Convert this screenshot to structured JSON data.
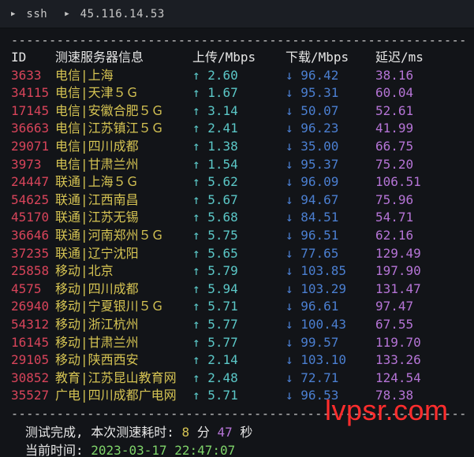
{
  "titlebar": {
    "shell": "ssh",
    "host": "45.116.14.53"
  },
  "separator": "----------------------------------------------------------------------------------",
  "columns": {
    "id": "ID",
    "server": "测速服务器信息",
    "upload": "上传/Mbps",
    "download": "下载/Mbps",
    "latency": "延迟/ms"
  },
  "rows": [
    {
      "id": "3633",
      "server": "电信|上海",
      "upload": "↑ 2.60",
      "download": "↓ 96.42",
      "latency": "38.16"
    },
    {
      "id": "34115",
      "server": "电信|天津５Ｇ",
      "upload": "↑ 1.67",
      "download": "↓ 95.31",
      "latency": "60.04"
    },
    {
      "id": "17145",
      "server": "电信|安徽合肥５Ｇ",
      "upload": "↑ 3.14",
      "download": "↓ 50.07",
      "latency": "52.61"
    },
    {
      "id": "36663",
      "server": "电信|江苏镇江５Ｇ",
      "upload": "↑ 2.41",
      "download": "↓ 96.23",
      "latency": "41.99"
    },
    {
      "id": "29071",
      "server": "电信|四川成都",
      "upload": "↑ 1.38",
      "download": "↓ 35.00",
      "latency": "66.75"
    },
    {
      "id": "3973",
      "server": "电信|甘肃兰州",
      "upload": "↑ 1.54",
      "download": "↓ 95.37",
      "latency": "75.20"
    },
    {
      "id": "24447",
      "server": "联通|上海５Ｇ",
      "upload": "↑ 5.62",
      "download": "↓ 96.09",
      "latency": "106.51"
    },
    {
      "id": "54625",
      "server": "联通|江西南昌",
      "upload": "↑ 5.67",
      "download": "↓ 94.67",
      "latency": "75.96"
    },
    {
      "id": "45170",
      "server": "联通|江苏无锡",
      "upload": "↑ 5.68",
      "download": "↓ 84.51",
      "latency": "54.71"
    },
    {
      "id": "36646",
      "server": "联通|河南郑州５Ｇ",
      "upload": "↑ 5.75",
      "download": "↓ 96.51",
      "latency": "62.16"
    },
    {
      "id": "37235",
      "server": "联通|辽宁沈阳",
      "upload": "↑ 5.65",
      "download": "↓ 77.65",
      "latency": "129.49"
    },
    {
      "id": "25858",
      "server": "移动|北京",
      "upload": "↑ 5.79",
      "download": "↓ 103.85",
      "latency": "197.90"
    },
    {
      "id": "4575",
      "server": "移动|四川成都",
      "upload": "↑ 5.94",
      "download": "↓ 103.29",
      "latency": "131.47"
    },
    {
      "id": "26940",
      "server": "移动|宁夏银川５Ｇ",
      "upload": "↑ 5.71",
      "download": "↓ 96.61",
      "latency": "97.47"
    },
    {
      "id": "54312",
      "server": "移动|浙江杭州",
      "upload": "↑ 5.77",
      "download": "↓ 100.43",
      "latency": "67.55"
    },
    {
      "id": "16145",
      "server": "移动|甘肃兰州",
      "upload": "↑ 5.77",
      "download": "↓ 99.57",
      "latency": "119.70"
    },
    {
      "id": "29105",
      "server": "移动|陕西西安",
      "upload": "↑ 2.14",
      "download": "↓ 103.10",
      "latency": "133.26"
    },
    {
      "id": "30852",
      "server": "教育|江苏昆山教育网",
      "upload": "↑ 2.48",
      "download": "↓ 72.71",
      "latency": "124.54"
    },
    {
      "id": "35527",
      "server": "广电|四川成都广电网",
      "upload": "↑ 5.71",
      "download": "↓ 96.53",
      "latency": "78.38"
    }
  ],
  "footer": {
    "complete_prefix": "测试完成, 本次测速耗时: ",
    "minutes": "8",
    "minutes_unit": " 分 ",
    "seconds": "47",
    "seconds_unit": " 秒",
    "time_label": "当前时间: ",
    "time_value": "2023-03-17 22:47:07"
  },
  "watermark": "lvpsr.com",
  "colors": {
    "id": "#d8445a",
    "server": "#d6c453",
    "upload": "#5bc7c7",
    "download": "#4b7fd1",
    "latency": "#b574d6",
    "watermark": "#ff2d2d"
  },
  "icons": {
    "titlebar_chevron": "chevron-right-icon"
  }
}
